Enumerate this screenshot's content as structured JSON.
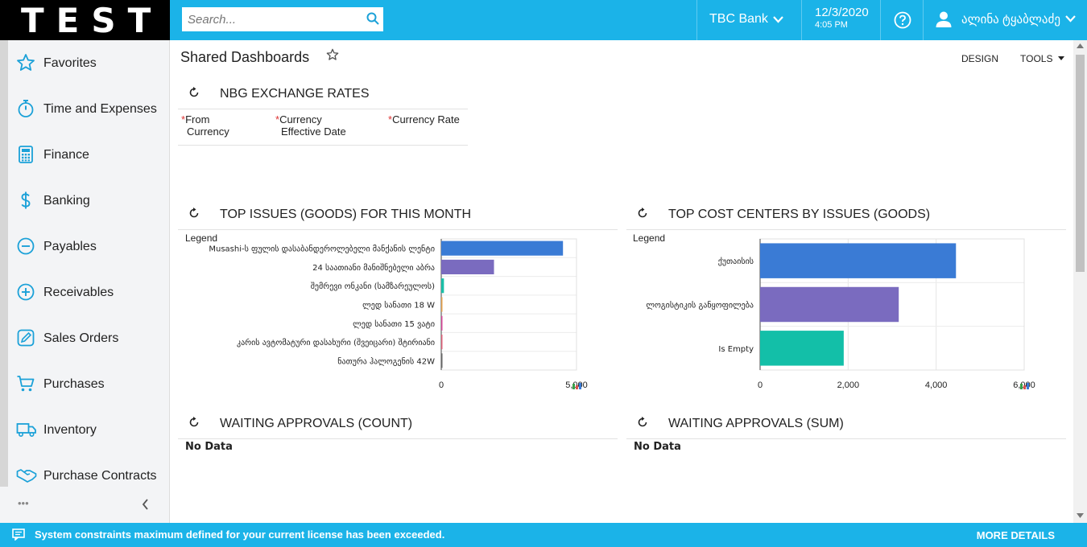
{
  "app": {
    "logo": "TEST"
  },
  "search": {
    "placeholder": "Search..."
  },
  "header": {
    "company": "TBC Bank",
    "date": "12/3/2020",
    "time": "4:05 PM",
    "user": "ალინა ტყაბლაძე"
  },
  "sidebar": {
    "items": [
      {
        "label": "Favorites",
        "icon": "star-icon"
      },
      {
        "label": "Time and Expenses",
        "icon": "stopwatch-icon"
      },
      {
        "label": "Finance",
        "icon": "calculator-icon"
      },
      {
        "label": "Banking",
        "icon": "dollar-icon"
      },
      {
        "label": "Payables",
        "icon": "minus-circle-icon"
      },
      {
        "label": "Receivables",
        "icon": "plus-circle-icon"
      },
      {
        "label": "Sales Orders",
        "icon": "edit-icon"
      },
      {
        "label": "Purchases",
        "icon": "cart-icon"
      },
      {
        "label": "Inventory",
        "icon": "truck-icon"
      },
      {
        "label": "Purchase Contracts",
        "icon": "handshake-icon"
      }
    ],
    "more_label": "•••"
  },
  "page": {
    "title": "Shared Dashboards",
    "design_label": "DESIGN",
    "tools_label": "TOOLS"
  },
  "widgets": {
    "nbg": {
      "title": "NBG EXCHANGE RATES",
      "columns": [
        {
          "line1": "From",
          "line2": "Currency"
        },
        {
          "line1": "Currency",
          "line2": "Effective Date"
        },
        {
          "line1": "Currency Rate",
          "line2": ""
        }
      ],
      "required_mark": "*"
    },
    "top_issues": {
      "title": "TOP ISSUES (GOODS) FOR THIS MONTH",
      "legend": "Legend"
    },
    "top_cost": {
      "title": "TOP COST CENTERS BY ISSUES (GOODS)",
      "legend": "Legend"
    },
    "approvals_count": {
      "title": "WAITING APPROVALS (COUNT)",
      "empty": "No Data"
    },
    "approvals_sum": {
      "title": "WAITING APPROVALS (SUM)",
      "empty": "No Data"
    }
  },
  "chart_data": [
    {
      "type": "bar",
      "orientation": "horizontal",
      "categories": [
        "Musashi-ს ფულის დასაბანდეროლებელი მანქანის ლენტი",
        "24 საათიანი მანიშნებელი აბრა",
        "შემრევი ონკანი (სამზარეულოს)",
        "ლედ სანათი 18 W",
        "ლედ სანათი 15 ვატი",
        "კარის ავტომატური დასახური (შვეიცარი) შტირიანი",
        "ნათურა ჰალოგენის 42W"
      ],
      "values": [
        4500,
        1950,
        100,
        40,
        30,
        20,
        15
      ],
      "colors": [
        "#3a7bd5",
        "#7a6bbf",
        "#1bbfa8",
        "#e8a14a",
        "#d9479a",
        "#e0607a",
        "#666666"
      ],
      "xlim": [
        0,
        5000
      ],
      "xticks": [
        "0",
        "5,000"
      ]
    },
    {
      "type": "bar",
      "orientation": "horizontal",
      "categories": [
        "ქუთაისის",
        "ლოგისტიკის განყოფილება",
        "Is Empty"
      ],
      "values": [
        4450,
        3150,
        1900
      ],
      "colors": [
        "#3a7bd5",
        "#7a6bbf",
        "#13bfa8"
      ],
      "xlim": [
        0,
        6000
      ],
      "xticks": [
        "0",
        "2,000",
        "4,000",
        "6,000"
      ]
    }
  ],
  "footer": {
    "message": "System constraints maximum defined for your current license has been exceeded.",
    "more": "MORE DETAILS"
  },
  "colors": {
    "accent": "#1bb3e8",
    "logo_bg": "#000000"
  }
}
